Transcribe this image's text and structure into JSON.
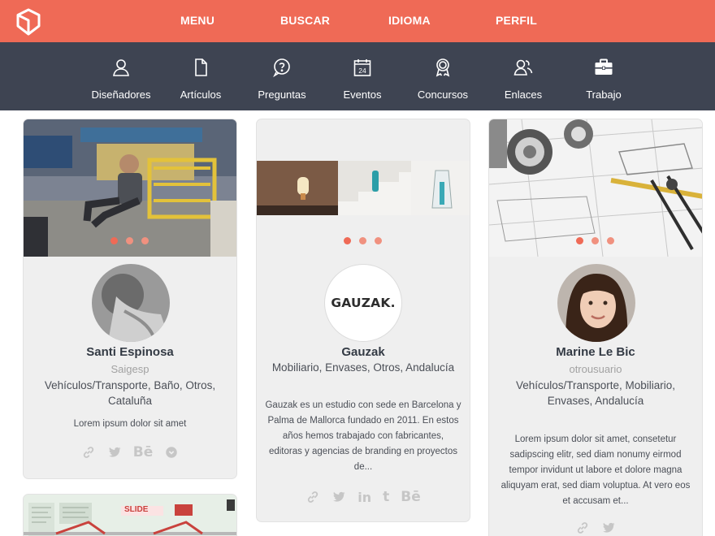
{
  "topnav": {
    "items": [
      {
        "label": "MENU"
      },
      {
        "label": "BUSCAR"
      },
      {
        "label": "IDIOMA"
      },
      {
        "label": "PERFIL"
      }
    ]
  },
  "subnav": {
    "items": [
      {
        "label": "Diseñadores",
        "icon": "user-icon"
      },
      {
        "label": "Artículos",
        "icon": "document-icon"
      },
      {
        "label": "Preguntas",
        "icon": "question-icon"
      },
      {
        "label": "Eventos",
        "icon": "calendar-icon"
      },
      {
        "label": "Concursos",
        "icon": "award-icon"
      },
      {
        "label": "Enlaces",
        "icon": "users-link-icon"
      },
      {
        "label": "Trabajo",
        "icon": "briefcase-icon"
      }
    ]
  },
  "cards": [
    {
      "name": "Santi Espinosa",
      "username": "Saigesp",
      "tags": "Vehículos/Transporte, Baño, Otros, Cataluña",
      "description": "Lorem ipsum dolor sit amet",
      "socials": [
        "link-icon",
        "twitter-icon",
        "behance-icon",
        "dribbble-icon"
      ]
    },
    {
      "name": "Gauzak",
      "logo_text": "GAUZAK.",
      "tags": "Mobiliario, Envases, Otros, Andalucía",
      "description": "Gauzak es un estudio con sede en Barcelona y Palma de Mallorca fundado en 2011. En estos años hemos trabajado con fabricantes, editoras y agencias de branding en proyectos de...",
      "socials": [
        "link-icon",
        "twitter-icon",
        "linkedin-icon",
        "tumblr-icon",
        "behance-icon"
      ]
    },
    {
      "name": "Marine Le Bic",
      "username": "otrousuario",
      "tags": "Vehículos/Transporte, Mobiliario, Envases, Andalucía",
      "description": "Lorem ipsum dolor sit amet, consetetur sadipscing elitr, sed diam nonumy eirmod tempor invidunt ut labore et dolore magna aliquyam erat, sed diam voluptua. At vero eos et accusam et...",
      "socials": [
        "link-icon",
        "twitter-icon"
      ]
    }
  ],
  "fourth_card": {
    "thumb_text": "SLIDE"
  },
  "colors": {
    "brand": "#ef6a56",
    "subnav_bg": "#3e4452",
    "card_bg": "#efefef"
  }
}
